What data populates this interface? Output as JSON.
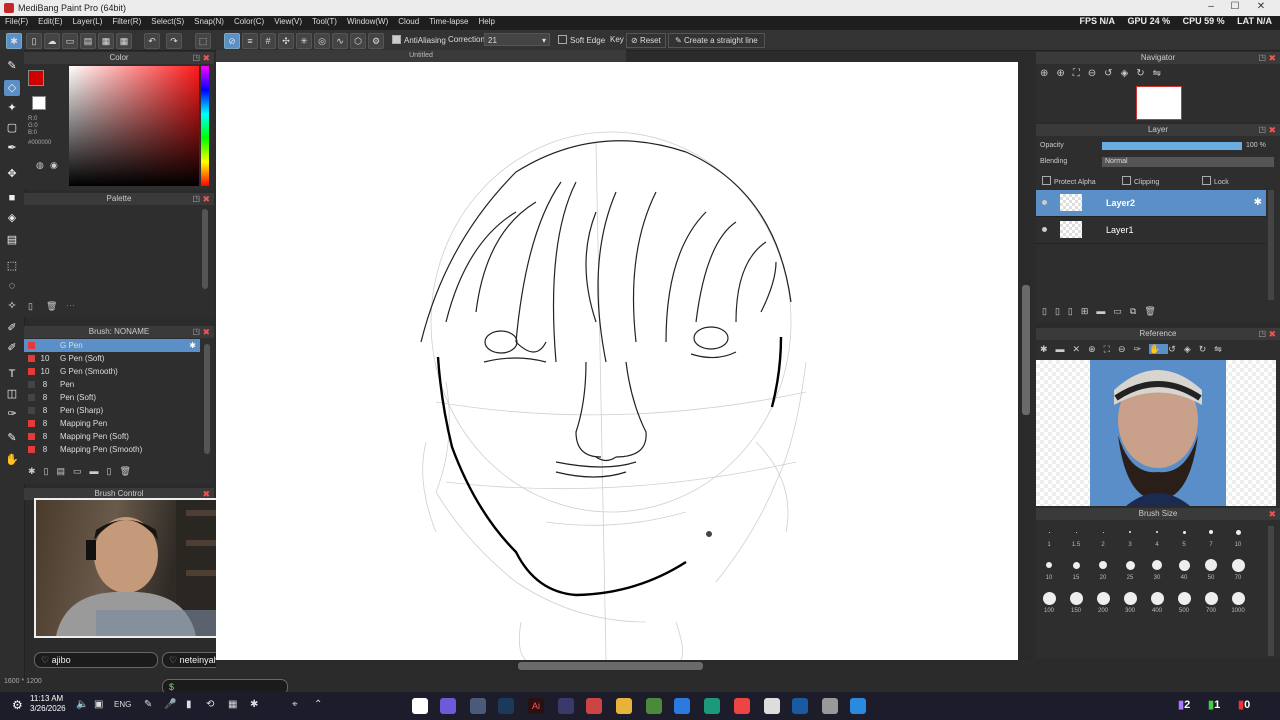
{
  "app": {
    "title": "MediBang Paint Pro (64bit)"
  },
  "window_controls": {
    "minimize": "–",
    "maximize": "☐",
    "close": "✕"
  },
  "menu": [
    "File(F)",
    "Edit(E)",
    "Layer(L)",
    "Filter(R)",
    "Select(S)",
    "Snap(N)",
    "Color(C)",
    "View(V)",
    "Tool(T)",
    "Window(W)",
    "Cloud",
    "Time-lapse",
    "Help"
  ],
  "stats": {
    "fps_label": "FPS",
    "fps": "N/A",
    "gpu_label": "GPU",
    "gpu": "24 %",
    "cpu_label": "CPU",
    "cpu": "59 %",
    "lat_label": "LAT",
    "lat": "N/A"
  },
  "toolbar": {
    "antialiasing_label": "AntiAliasing",
    "correction_label": "Correction",
    "correction_value": "21",
    "soft_edge_label": "Soft Edge",
    "key_label": "Key",
    "reset_label": "Reset",
    "straight_line_label": "Create a straight line"
  },
  "document": {
    "tab_title": "Untitled",
    "status": "1600 * 1200"
  },
  "color_panel": {
    "title": "Color",
    "r": "R:0",
    "g": "G:0",
    "b": "B:0",
    "hex": "#000000",
    "primary": "#d00000",
    "secondary": "#ffffff"
  },
  "palette_panel": {
    "title": "Palette"
  },
  "brush_panel": {
    "title": "Brush: NONAME",
    "items": [
      {
        "size": "",
        "name": "G Pen",
        "selected": true
      },
      {
        "size": "10",
        "name": "G Pen (Soft)"
      },
      {
        "size": "10",
        "name": "G Pen (Smooth)"
      },
      {
        "size": "8",
        "name": "Pen"
      },
      {
        "size": "8",
        "name": "Pen (Soft)"
      },
      {
        "size": "8",
        "name": "Pen (Sharp)"
      },
      {
        "size": "8",
        "name": "Mapping Pen"
      },
      {
        "size": "8",
        "name": "Mapping Pen (Soft)"
      },
      {
        "size": "8",
        "name": "Mapping Pen (Smooth)"
      }
    ]
  },
  "brush_control": {
    "title": "Brush Control"
  },
  "chat": {
    "user1": "ajibo",
    "user2": "neteinyahu"
  },
  "navigator": {
    "title": "Navigator"
  },
  "layer_panel": {
    "title": "Layer",
    "opacity_label": "Opacity",
    "opacity_value": "100 %",
    "opacity": 1.0,
    "blending_label": "Blending",
    "blending_value": "Normal",
    "protect_alpha": "Protect Alpha",
    "clipping": "Clipping",
    "lock": "Lock",
    "layers": [
      {
        "name": "Layer2",
        "selected": true
      },
      {
        "name": "Layer1",
        "selected": false
      }
    ]
  },
  "reference_panel": {
    "title": "Reference"
  },
  "brush_size_panel": {
    "title": "Brush Size",
    "rows": [
      [
        "1",
        "1.5",
        "2",
        "3",
        "4",
        "5",
        "7",
        "10"
      ],
      [
        "10",
        "15",
        "20",
        "25",
        "30",
        "40",
        "50",
        "70"
      ],
      [
        "100",
        "150",
        "200",
        "300",
        "400",
        "500",
        "700",
        "1000"
      ]
    ]
  },
  "taskbar": {
    "time": "11:13 AM",
    "date": "3/26/2026",
    "lang": "ENG",
    "badge1": "2",
    "badge2": "1",
    "badge3": "0"
  },
  "colors": {
    "accent": "#5b8fc7",
    "panel": "#2e2e2e",
    "canvas": "#ffffff"
  }
}
